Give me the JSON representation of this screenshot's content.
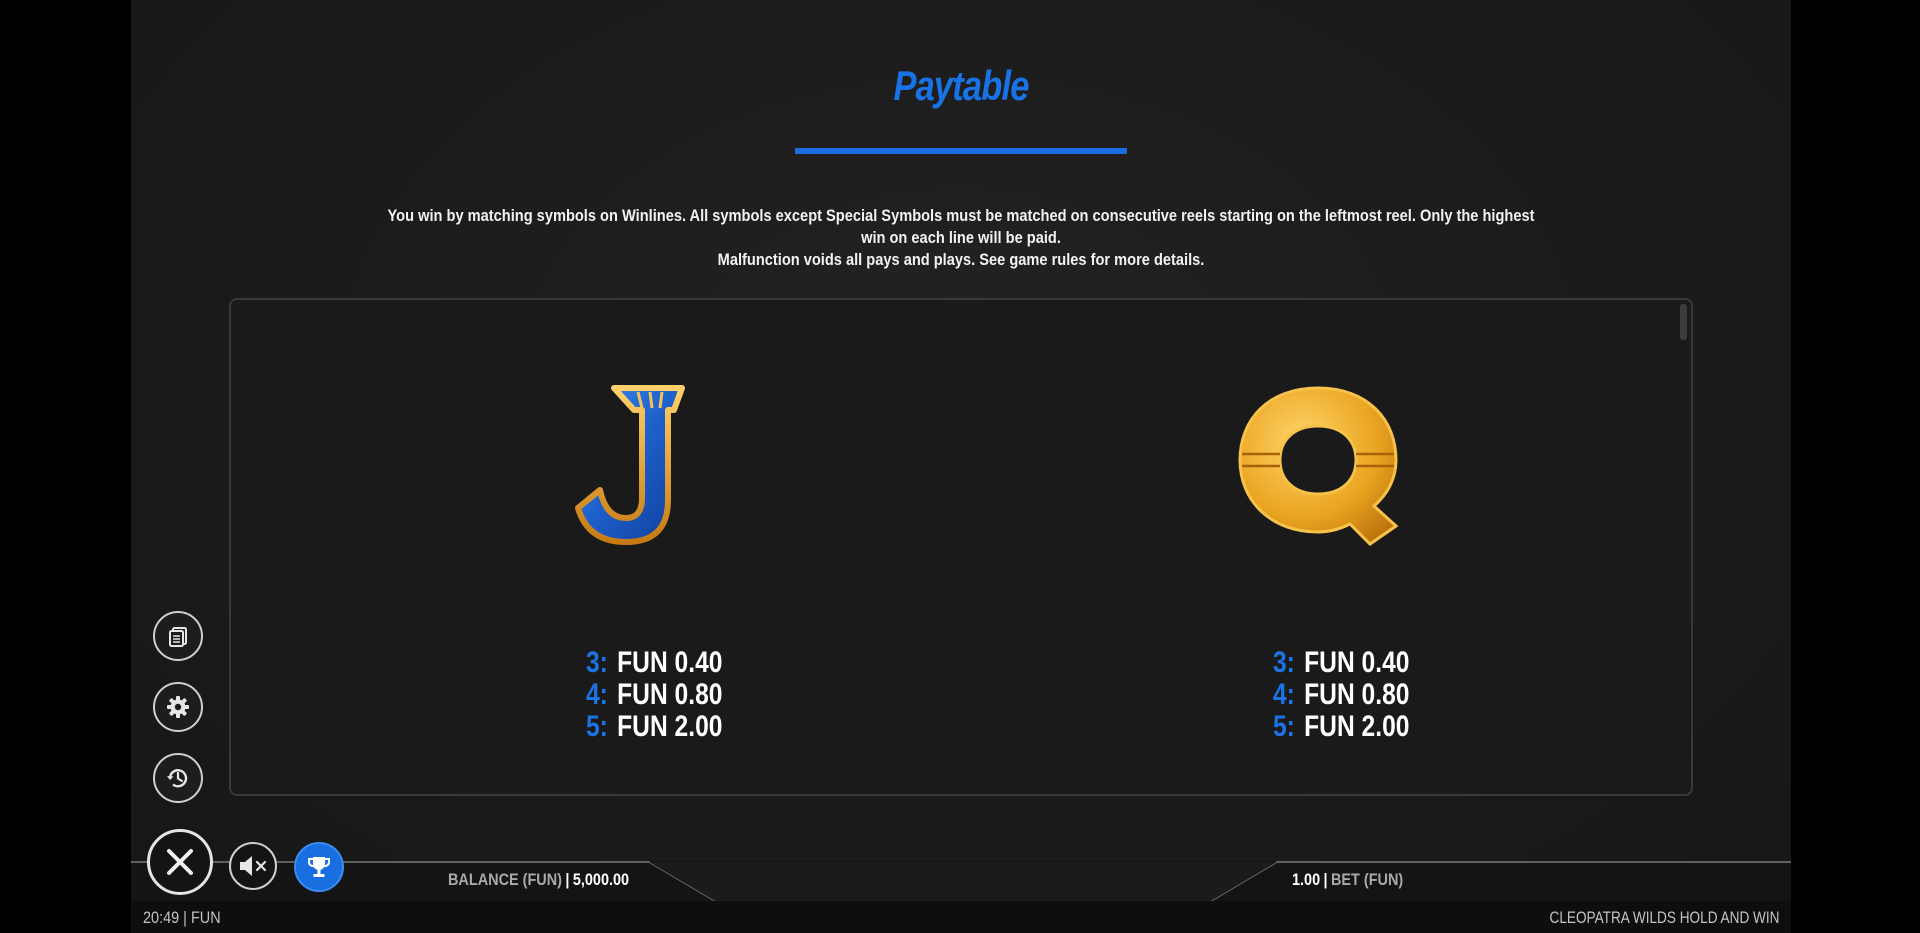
{
  "paytable": {
    "title": "Paytable",
    "intro_line1": "You win by matching symbols on Winlines. All symbols except Special Symbols must be matched on consecutive reels starting on the leftmost reel. Only the highest win on each line will be paid.",
    "intro_line2": "Malfunction voids all pays and plays. See game rules for more details.",
    "symbols": [
      {
        "icon": "letter-j-symbol-icon",
        "glyph": "J",
        "pays": [
          {
            "count": "3:",
            "amount": "FUN 0.40"
          },
          {
            "count": "4:",
            "amount": "FUN 0.80"
          },
          {
            "count": "5:",
            "amount": "FUN 2.00"
          }
        ]
      },
      {
        "icon": "letter-q-symbol-icon",
        "glyph": "Q",
        "pays": [
          {
            "count": "3:",
            "amount": "FUN 0.40"
          },
          {
            "count": "4:",
            "amount": "FUN 0.80"
          },
          {
            "count": "5:",
            "amount": "FUN 2.00"
          }
        ]
      }
    ]
  },
  "controls": {
    "paytable_icon": "paytable-icon",
    "settings_icon": "gear-icon",
    "history_icon": "history-icon",
    "close_icon": "close-icon",
    "mute_icon": "speaker-muted-icon",
    "trophy_icon": "trophy-icon"
  },
  "status": {
    "balance_label": "BALANCE (FUN)",
    "balance_sep": "|",
    "balance_value": "5,000.00",
    "bet_value": "1.00",
    "bet_sep": "|",
    "bet_label": "BET (FUN)"
  },
  "footer": {
    "clock_mode": "20:49 | FUN",
    "game_name": "CLEOPATRA WILDS HOLD AND WIN"
  },
  "colors": {
    "accent_blue": "#1773e6",
    "gold": "#e8a21c",
    "panel_bg": "#1b1a1b"
  }
}
